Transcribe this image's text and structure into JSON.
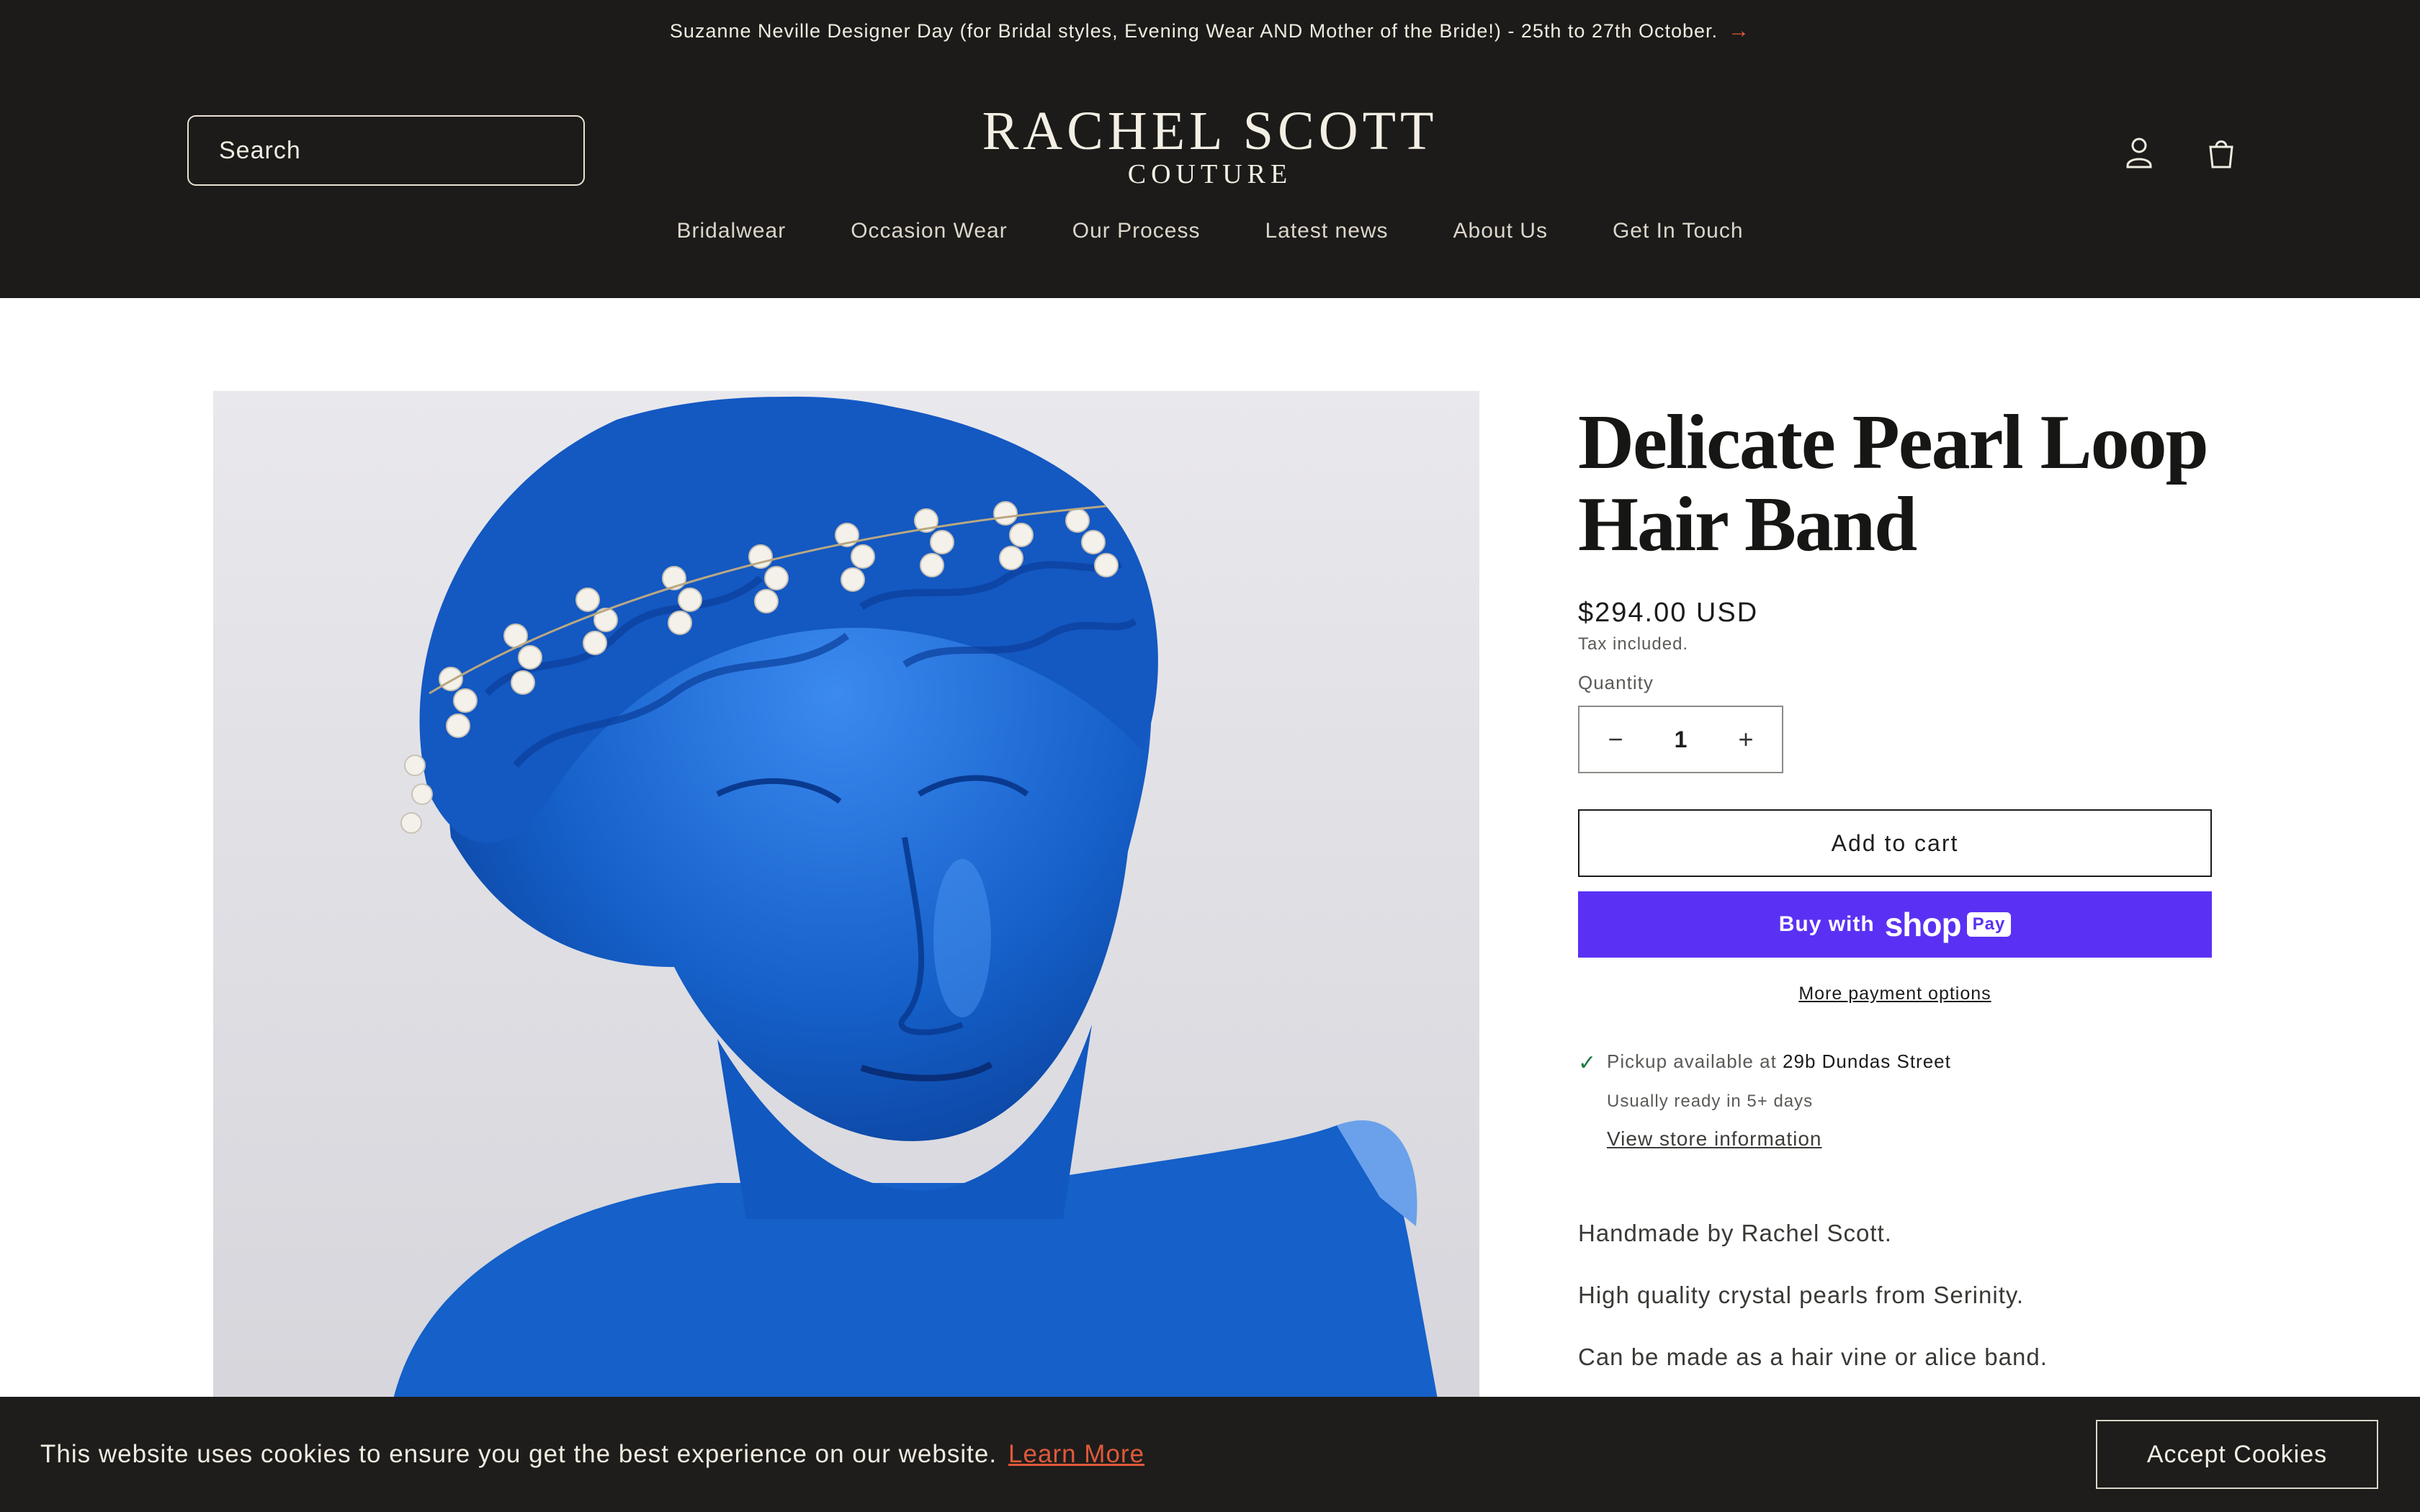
{
  "announcement": {
    "text": "Suzanne Neville Designer Day (for Bridal styles, Evening Wear AND Mother of the Bride!) - 25th to 27th October.",
    "arrow": "→"
  },
  "header": {
    "search_placeholder": "Search",
    "logo_line1": "RACHEL SCOTT",
    "logo_line2": "COUTURE",
    "account_icon": "account-icon",
    "cart_icon": "cart-icon"
  },
  "nav": {
    "items": [
      {
        "label": "Bridalwear"
      },
      {
        "label": "Occasion Wear"
      },
      {
        "label": "Our Process"
      },
      {
        "label": "Latest news"
      },
      {
        "label": "About Us"
      },
      {
        "label": "Get In Touch"
      }
    ]
  },
  "product": {
    "title": "Delicate Pearl Loop Hair Band",
    "price": "$294.00 USD",
    "tax_note": "Tax included.",
    "quantity_label": "Quantity",
    "quantity_value": "1",
    "minus": "−",
    "plus": "+",
    "add_to_cart": "Add to cart",
    "buy_with": "Buy with",
    "shop_brand": "shop",
    "pay_badge": "Pay",
    "more_payment": "More payment options",
    "pickup_prefix": "Pickup available at",
    "pickup_location": "29b Dundas Street",
    "ready_note": "Usually ready in 5+ days",
    "store_link": "View store information",
    "description": [
      "Handmade by Rachel Scott.",
      "High quality crystal pearls from Serinity.",
      "Can be made as a hair vine or alice band."
    ]
  },
  "cookie": {
    "message": "This website uses cookies to ensure you get the best experience on our website.",
    "learn_more": "Learn More",
    "accept": "Accept Cookies"
  },
  "colors": {
    "header_bg": "#1c1b19",
    "accent_orange": "#e0593b",
    "shop_pay": "#5a31f4",
    "statue_blue": "#1560c9"
  }
}
